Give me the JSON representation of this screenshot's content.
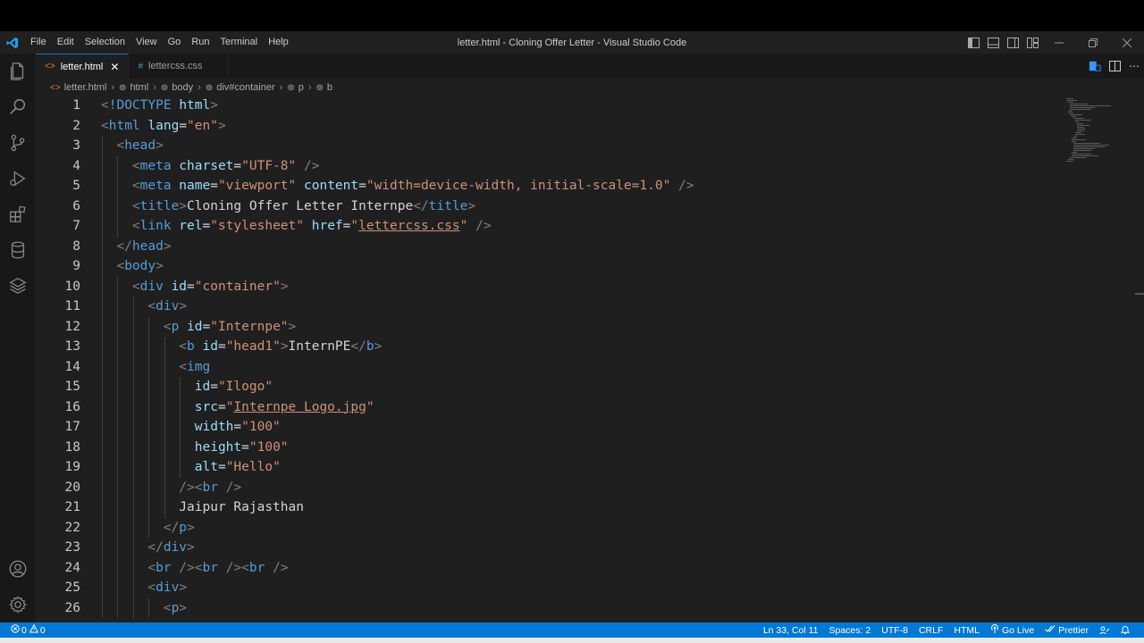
{
  "window": {
    "title": "letter.html - Cloning Offer Letter - Visual Studio Code",
    "menu": [
      "File",
      "Edit",
      "Selection",
      "View",
      "Go",
      "Run",
      "Terminal",
      "Help"
    ]
  },
  "tabs": [
    {
      "label": "letter.html",
      "icon": "html-file-icon",
      "active": true
    },
    {
      "label": "lettercss.css",
      "icon": "css-file-icon",
      "active": false
    }
  ],
  "breadcrumb": [
    "letter.html",
    "html",
    "body",
    "div#container",
    "p",
    "b"
  ],
  "editor": {
    "lines": [
      {
        "n": "1",
        "indent": 0,
        "tokens": [
          [
            "t-punc",
            "<"
          ],
          [
            "t-tag",
            "!DOCTYPE"
          ],
          [
            "t-text",
            " "
          ],
          [
            "t-attr",
            "html"
          ],
          [
            "t-punc",
            ">"
          ]
        ]
      },
      {
        "n": "2",
        "indent": 0,
        "tokens": [
          [
            "t-punc",
            "<"
          ],
          [
            "t-tag",
            "html"
          ],
          [
            "t-text",
            " "
          ],
          [
            "t-attr",
            "lang"
          ],
          [
            "t-text",
            "="
          ],
          [
            "t-str",
            "\"en\""
          ],
          [
            "t-punc",
            ">"
          ]
        ]
      },
      {
        "n": "3",
        "indent": 1,
        "tokens": [
          [
            "t-punc",
            "<"
          ],
          [
            "t-tag",
            "head"
          ],
          [
            "t-punc",
            ">"
          ]
        ]
      },
      {
        "n": "4",
        "indent": 2,
        "tokens": [
          [
            "t-punc",
            "<"
          ],
          [
            "t-tag",
            "meta"
          ],
          [
            "t-text",
            " "
          ],
          [
            "t-attr",
            "charset"
          ],
          [
            "t-text",
            "="
          ],
          [
            "t-str",
            "\"UTF-8\""
          ],
          [
            "t-text",
            " "
          ],
          [
            "t-punc",
            "/>"
          ]
        ]
      },
      {
        "n": "5",
        "indent": 2,
        "tokens": [
          [
            "t-punc",
            "<"
          ],
          [
            "t-tag",
            "meta"
          ],
          [
            "t-text",
            " "
          ],
          [
            "t-attr",
            "name"
          ],
          [
            "t-text",
            "="
          ],
          [
            "t-str",
            "\"viewport\""
          ],
          [
            "t-text",
            " "
          ],
          [
            "t-attr",
            "content"
          ],
          [
            "t-text",
            "="
          ],
          [
            "t-str",
            "\"width=device-width, initial-scale=1.0\""
          ],
          [
            "t-text",
            " "
          ],
          [
            "t-punc",
            "/>"
          ]
        ]
      },
      {
        "n": "6",
        "indent": 2,
        "tokens": [
          [
            "t-punc",
            "<"
          ],
          [
            "t-tag",
            "title"
          ],
          [
            "t-punc",
            ">"
          ],
          [
            "t-text",
            "Cloning Offer Letter Internpe"
          ],
          [
            "t-punc",
            "</"
          ],
          [
            "t-tag",
            "title"
          ],
          [
            "t-punc",
            ">"
          ]
        ]
      },
      {
        "n": "7",
        "indent": 2,
        "tokens": [
          [
            "t-punc",
            "<"
          ],
          [
            "t-tag",
            "link"
          ],
          [
            "t-text",
            " "
          ],
          [
            "t-attr",
            "rel"
          ],
          [
            "t-text",
            "="
          ],
          [
            "t-str",
            "\"stylesheet\""
          ],
          [
            "t-text",
            " "
          ],
          [
            "t-attr",
            "href"
          ],
          [
            "t-text",
            "="
          ],
          [
            "t-str",
            "\""
          ],
          [
            "t-link",
            "lettercss.css"
          ],
          [
            "t-str",
            "\""
          ],
          [
            "t-text",
            " "
          ],
          [
            "t-punc",
            "/>"
          ]
        ]
      },
      {
        "n": "8",
        "indent": 1,
        "tokens": [
          [
            "t-punc",
            "</"
          ],
          [
            "t-tag",
            "head"
          ],
          [
            "t-punc",
            ">"
          ]
        ]
      },
      {
        "n": "9",
        "indent": 1,
        "tokens": [
          [
            "t-punc",
            "<"
          ],
          [
            "t-tag",
            "body"
          ],
          [
            "t-punc",
            ">"
          ]
        ]
      },
      {
        "n": "10",
        "indent": 2,
        "tokens": [
          [
            "t-punc",
            "<"
          ],
          [
            "t-tag",
            "div"
          ],
          [
            "t-text",
            " "
          ],
          [
            "t-attr",
            "id"
          ],
          [
            "t-text",
            "="
          ],
          [
            "t-str",
            "\"container\""
          ],
          [
            "t-punc",
            ">"
          ]
        ]
      },
      {
        "n": "11",
        "indent": 3,
        "tokens": [
          [
            "t-punc",
            "<"
          ],
          [
            "t-tag",
            "div"
          ],
          [
            "t-punc",
            ">"
          ]
        ]
      },
      {
        "n": "12",
        "indent": 4,
        "tokens": [
          [
            "t-punc",
            "<"
          ],
          [
            "t-tag",
            "p"
          ],
          [
            "t-text",
            " "
          ],
          [
            "t-attr",
            "id"
          ],
          [
            "t-text",
            "="
          ],
          [
            "t-str",
            "\"Internpe\""
          ],
          [
            "t-punc",
            ">"
          ]
        ]
      },
      {
        "n": "13",
        "indent": 5,
        "tokens": [
          [
            "t-punc",
            "<"
          ],
          [
            "t-tag",
            "b"
          ],
          [
            "t-text",
            " "
          ],
          [
            "t-attr",
            "id"
          ],
          [
            "t-text",
            "="
          ],
          [
            "t-str",
            "\"head1\""
          ],
          [
            "t-punc",
            ">"
          ],
          [
            "t-text",
            "InternPE"
          ],
          [
            "t-punc",
            "</"
          ],
          [
            "t-tag",
            "b"
          ],
          [
            "t-punc",
            ">"
          ]
        ]
      },
      {
        "n": "14",
        "indent": 5,
        "tokens": [
          [
            "t-punc",
            "<"
          ],
          [
            "t-tag",
            "img"
          ]
        ]
      },
      {
        "n": "15",
        "indent": 6,
        "tokens": [
          [
            "t-attr",
            "id"
          ],
          [
            "t-text",
            "="
          ],
          [
            "t-str",
            "\"Ilogo\""
          ]
        ]
      },
      {
        "n": "16",
        "indent": 6,
        "tokens": [
          [
            "t-attr",
            "src"
          ],
          [
            "t-text",
            "="
          ],
          [
            "t-str",
            "\""
          ],
          [
            "t-link",
            "Internpe Logo.jpg"
          ],
          [
            "t-str",
            "\""
          ]
        ]
      },
      {
        "n": "17",
        "indent": 6,
        "tokens": [
          [
            "t-attr",
            "width"
          ],
          [
            "t-text",
            "="
          ],
          [
            "t-str",
            "\"100\""
          ]
        ]
      },
      {
        "n": "18",
        "indent": 6,
        "tokens": [
          [
            "t-attr",
            "height"
          ],
          [
            "t-text",
            "="
          ],
          [
            "t-str",
            "\"100\""
          ]
        ]
      },
      {
        "n": "19",
        "indent": 6,
        "tokens": [
          [
            "t-attr",
            "alt"
          ],
          [
            "t-text",
            "="
          ],
          [
            "t-str",
            "\"Hello\""
          ]
        ]
      },
      {
        "n": "20",
        "indent": 5,
        "tokens": [
          [
            "t-punc",
            "/><"
          ],
          [
            "t-tag",
            "br"
          ],
          [
            "t-text",
            " "
          ],
          [
            "t-punc",
            "/>"
          ]
        ]
      },
      {
        "n": "21",
        "indent": 5,
        "tokens": [
          [
            "t-text",
            "Jaipur Rajasthan"
          ]
        ]
      },
      {
        "n": "22",
        "indent": 4,
        "tokens": [
          [
            "t-punc",
            "</"
          ],
          [
            "t-tag",
            "p"
          ],
          [
            "t-punc",
            ">"
          ]
        ]
      },
      {
        "n": "23",
        "indent": 3,
        "tokens": [
          [
            "t-punc",
            "</"
          ],
          [
            "t-tag",
            "div"
          ],
          [
            "t-punc",
            ">"
          ]
        ]
      },
      {
        "n": "24",
        "indent": 3,
        "tokens": [
          [
            "t-punc",
            "<"
          ],
          [
            "t-tag",
            "br"
          ],
          [
            "t-text",
            " "
          ],
          [
            "t-punc",
            "/><"
          ],
          [
            "t-tag",
            "br"
          ],
          [
            "t-text",
            " "
          ],
          [
            "t-punc",
            "/><"
          ],
          [
            "t-tag",
            "br"
          ],
          [
            "t-text",
            " "
          ],
          [
            "t-punc",
            "/>"
          ]
        ]
      },
      {
        "n": "25",
        "indent": 3,
        "tokens": [
          [
            "t-punc",
            "<"
          ],
          [
            "t-tag",
            "div"
          ],
          [
            "t-punc",
            ">"
          ]
        ]
      },
      {
        "n": "26",
        "indent": 4,
        "tokens": [
          [
            "t-punc",
            "<"
          ],
          [
            "t-tag",
            "p"
          ],
          [
            "t-punc",
            ">"
          ]
        ]
      }
    ]
  },
  "status": {
    "errors": "0",
    "warnings": "0",
    "position": "Ln 33, Col 11",
    "spaces": "Spaces: 2",
    "encoding": "UTF-8",
    "eol": "CRLF",
    "language": "HTML",
    "golive": "Go Live",
    "prettier": "Prettier"
  },
  "colors": {
    "accent": "#0078d4",
    "editor_bg": "#1f1f1f",
    "tag": "#569cd6",
    "attr": "#9cdcfe",
    "string": "#ce9178"
  }
}
